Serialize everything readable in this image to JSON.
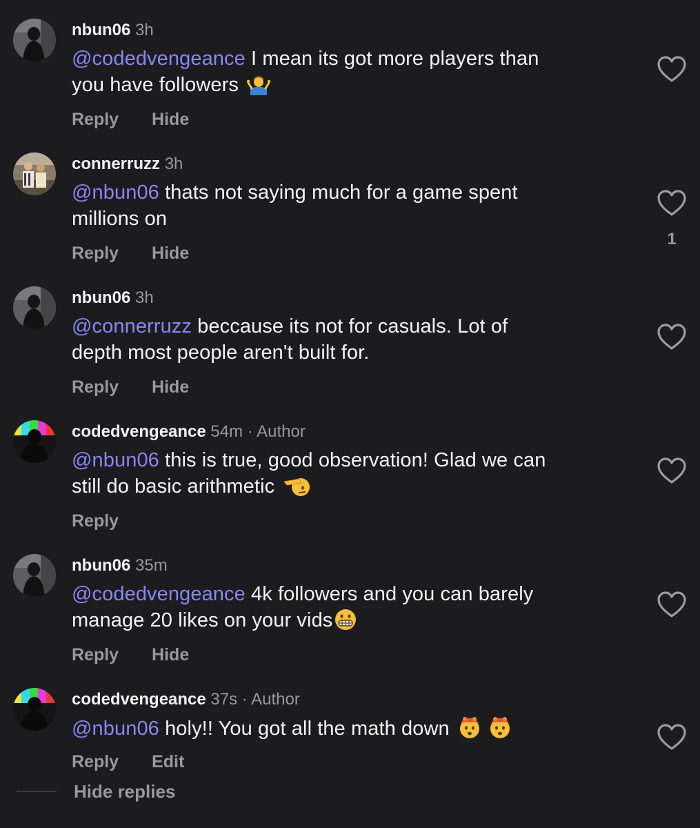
{
  "comments": [
    {
      "username": "nbun06",
      "time": "3h",
      "mention": "@codedvengeance",
      "text_line1": " I mean its got more players than",
      "text_line2": "you have followers ",
      "emoji": "person-shrugging-emoji",
      "actions": [
        "Reply",
        "Hide"
      ],
      "like_count": ""
    },
    {
      "username": "connerruzz",
      "time": "3h",
      "mention": "@nbun06",
      "text_line1": " thats not saying much for a game spent",
      "text_line2": "millions on",
      "actions": [
        "Reply",
        "Hide"
      ],
      "like_count": "1"
    },
    {
      "username": "nbun06",
      "time": "3h",
      "mention": "@connerruzz",
      "text_line1": " beccause its not for casuals. Lot of",
      "text_line2": "depth most people aren't built for.",
      "actions": [
        "Reply",
        "Hide"
      ],
      "like_count": ""
    },
    {
      "username": "codedvengeance",
      "time": "54m",
      "separator": "·",
      "author_label": "Author",
      "mention": "@nbun06",
      "text_line1": " this is true, good observation! Glad we can",
      "text_line2": "still do basic arithmetic ",
      "emoji": "saluting-face-emoji",
      "actions": [
        "Reply"
      ],
      "like_count": ""
    },
    {
      "username": "nbun06",
      "time": "35m",
      "mention": "@codedvengeance",
      "text_line1": " 4k followers and you can barely",
      "text_line2": "manage 20 likes on your vids",
      "emoji": "grimacing-face-emoji",
      "actions": [
        "Reply",
        "Hide"
      ],
      "like_count": ""
    },
    {
      "username": "codedvengeance",
      "time": "37s",
      "separator": "·",
      "author_label": "Author",
      "mention": "@nbun06",
      "text_line1": " holy!! You got all the math down ",
      "emoji": "exploding-head-emoji",
      "actions": [
        "Reply",
        "Edit"
      ],
      "like_count": ""
    }
  ],
  "hide_replies_label": "Hide replies",
  "colors": {
    "background": "#1c1c1f",
    "mention": "#8a86f5",
    "secondary_text": "#98989f",
    "primary_text": "#f2f2f4"
  }
}
